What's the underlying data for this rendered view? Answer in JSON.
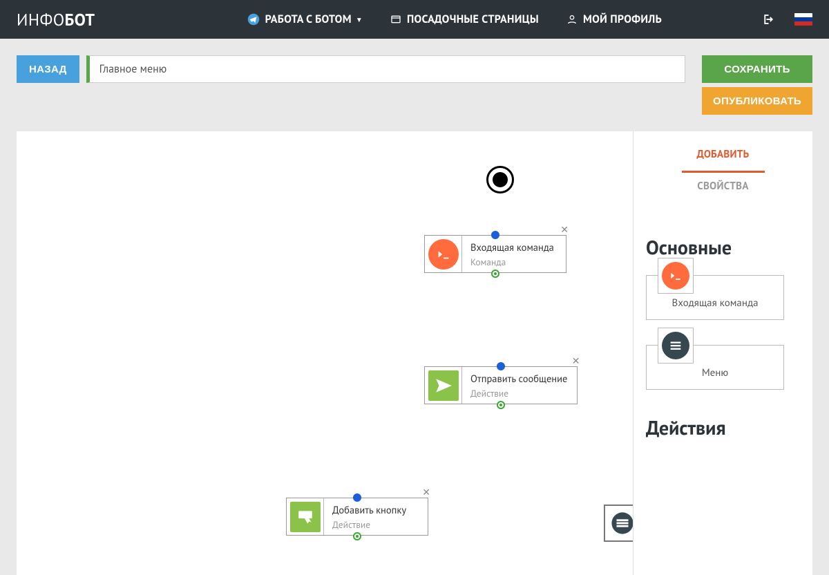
{
  "brand": {
    "prefix": "ИНФО",
    "bold": "БОТ"
  },
  "nav": {
    "bot": "РАБОТА С БОТОМ",
    "pages": "ПОСАДОЧНЫЕ СТРАНИЦЫ",
    "profile": "МОЙ ПРОФИЛЬ"
  },
  "actions": {
    "back": "НАЗАД",
    "title": "Главное меню",
    "save": "СОХРАНИТЬ",
    "publish": "ОПУБЛИКОВАТЬ"
  },
  "side": {
    "tab_add": "ДОБАВИТЬ",
    "tab_props": "СВОЙСТВА",
    "section_main": "Основные",
    "section_actions": "Действия",
    "palette": {
      "incoming": "Входящая команда",
      "menu": "Меню"
    }
  },
  "nodes": {
    "n1": {
      "title": "Входящая команда",
      "sub": "Команда"
    },
    "n2": {
      "title": "Отправить сообщение",
      "sub": "Действие"
    },
    "n3": {
      "title": "Добавить кнопку",
      "sub": "Действие"
    }
  },
  "glyphs": {
    "close": "✕"
  },
  "colors": {
    "orange": "#ff6b3d",
    "green": "#8bc34a",
    "dark": "#37474f"
  }
}
